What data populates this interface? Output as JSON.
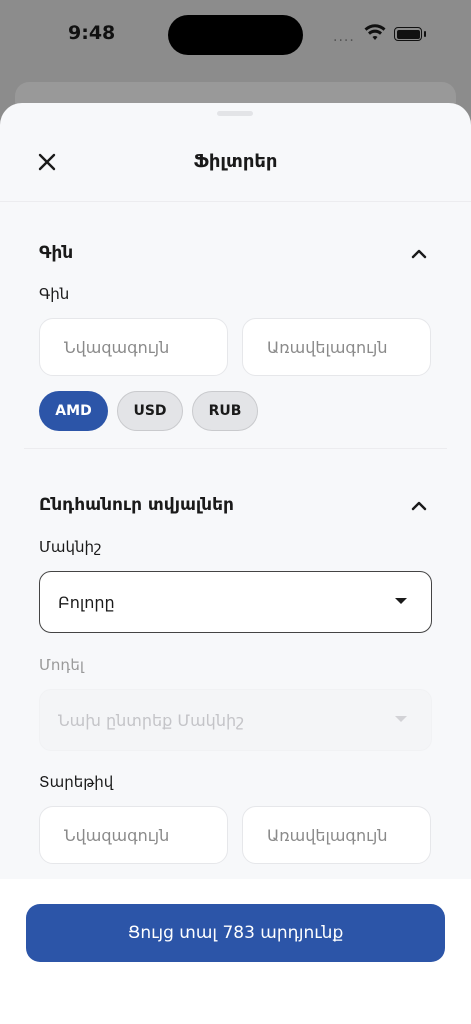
{
  "status_bar": {
    "time": "9:48",
    "signal": "····"
  },
  "sheet": {
    "title": "Ֆիլտրեր"
  },
  "price_section": {
    "title": "Գին",
    "field_label": "Գին",
    "min_placeholder": "Նվազագույն",
    "max_placeholder": "Առավելագույն",
    "currencies": [
      {
        "label": "AMD",
        "selected": true
      },
      {
        "label": "USD",
        "selected": false
      },
      {
        "label": "RUB",
        "selected": false
      }
    ]
  },
  "general_section": {
    "title": "Ընդհանուր տվյալներ",
    "make": {
      "label": "Մակնիշ",
      "value": "Բոլորը"
    },
    "model": {
      "label": "Մոդել",
      "placeholder": "Նախ ընտրեք Մակնիշ",
      "disabled": true
    },
    "year": {
      "label": "Տարեթիվ",
      "min_placeholder": "Նվազագույն",
      "max_placeholder": "Առավելագույն"
    }
  },
  "footer": {
    "cta_label": "Ցույց տալ 783 արդյունք"
  },
  "colors": {
    "accent": "#2c55a8",
    "sheet_bg": "#f7f8fa",
    "chip_inactive": "#e3e4e7"
  },
  "icons": [
    "close-icon",
    "chevron-up-icon",
    "caret-down-icon",
    "wifi-icon",
    "battery-icon"
  ]
}
